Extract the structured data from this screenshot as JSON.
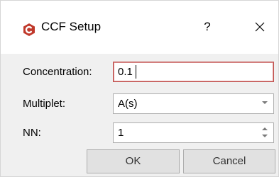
{
  "window": {
    "title": "CCF Setup",
    "help_label": "?",
    "close_label": "✕",
    "accent_color": "#c0392b"
  },
  "form": {
    "concentration": {
      "label": "Concentration:",
      "value": "0.1"
    },
    "multiplet": {
      "label": "Multiplet:",
      "value": "A(s)"
    },
    "nn": {
      "label": "NN:",
      "value": "1"
    }
  },
  "buttons": {
    "ok_label": "OK",
    "cancel_label": "Cancel"
  }
}
